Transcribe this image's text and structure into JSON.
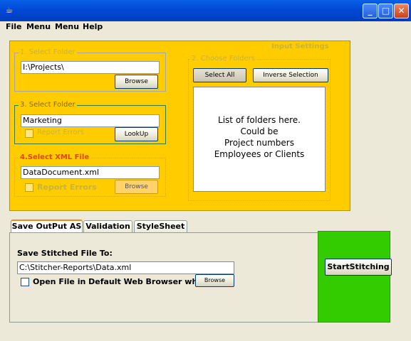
{
  "menu": {
    "items": [
      "File",
      "Menu",
      "Menu",
      "Help"
    ]
  },
  "window": {
    "buttons": {
      "minimize": "_",
      "maximize": "□",
      "close": "✕"
    }
  },
  "input_panel": {
    "title": "Input Settings",
    "group1": {
      "label": "1. Select Folder",
      "value": "I:\\Projects\\",
      "browse": "Browse"
    },
    "group2": {
      "label": "2. Choose Folders",
      "select_all": "Select All",
      "inverse": "Inverse Selection",
      "list_text": [
        "List of folders here.",
        "Could be",
        "Project numbers",
        "Employees or Clients"
      ]
    },
    "group3": {
      "label": "3. Select Folder",
      "value": "Marketing",
      "report_errors": "Report Errors",
      "lookup": "LookUp"
    },
    "group4": {
      "label": "4.Select XML File",
      "value": "DataDocument.xml",
      "report_errors": "Report Errors",
      "browse": "Browse"
    }
  },
  "tabs": [
    "Save OutPut AS",
    "Validation",
    "StyleSheet"
  ],
  "save_panel": {
    "heading": "Save Stitched File To:",
    "path": "C:\\Stitcher-Reports\\Data.xml",
    "open_label": "Open File in Default Web Browser when Stitc",
    "browse": "Browse"
  },
  "start_button": "StartStitching",
  "colors": {
    "panel": "#ffcc00",
    "green": "#33cc00",
    "titlebar": "#0049d6"
  }
}
